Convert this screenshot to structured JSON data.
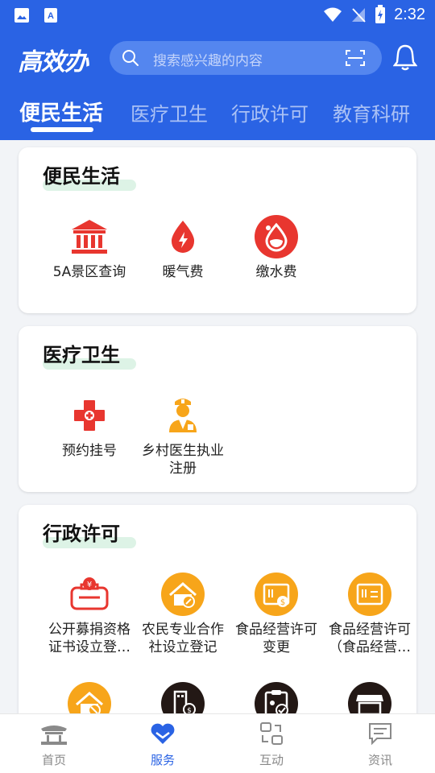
{
  "status": {
    "time": "2:32"
  },
  "header": {
    "logo": "高效办",
    "search_placeholder": "搜索感兴趣的内容"
  },
  "tabs": [
    {
      "label": "便民生活",
      "active": true
    },
    {
      "label": "医疗卫生",
      "active": false
    },
    {
      "label": "行政许可",
      "active": false
    },
    {
      "label": "教育科研",
      "active": false
    }
  ],
  "sections": [
    {
      "title": "便民生活",
      "items": [
        {
          "label": "5A景区查询",
          "icon": "bank-building-icon"
        },
        {
          "label": "暖气费",
          "icon": "flame-drop-icon"
        },
        {
          "label": "缴水费",
          "icon": "water-drop-icon"
        }
      ]
    },
    {
      "title": "医疗卫生",
      "items": [
        {
          "label": "预约挂号",
          "icon": "medical-cross-icon"
        },
        {
          "label": "乡村医生执业注册",
          "icon": "doctor-icon"
        }
      ]
    },
    {
      "title": "行政许可",
      "items": [
        {
          "label": "公开募捐资格证书设立登…",
          "icon": "donation-box-icon"
        },
        {
          "label": "农民专业合作社设立登记",
          "icon": "house-edit-icon"
        },
        {
          "label": "食品经营许可变更",
          "icon": "license-card-icon"
        },
        {
          "label": "食品经营许可（食品经营…",
          "icon": "license-doc-icon"
        },
        {
          "label": "",
          "icon": "house-cancel-icon"
        },
        {
          "label": "",
          "icon": "building-money-icon"
        },
        {
          "label": "",
          "icon": "clipboard-check-icon"
        },
        {
          "label": "",
          "icon": "shop-icon"
        }
      ]
    }
  ],
  "bottom_nav": [
    {
      "label": "首页",
      "icon": "pavilion-icon",
      "active": false
    },
    {
      "label": "服务",
      "icon": "heart-icon",
      "active": true
    },
    {
      "label": "互动",
      "icon": "exchange-icon",
      "active": false
    },
    {
      "label": "资讯",
      "icon": "news-chat-icon",
      "active": false
    }
  ],
  "colors": {
    "brand": "#2a63e4",
    "red": "#e8362f",
    "orange": "#f7a51a",
    "dark": "#231815"
  }
}
